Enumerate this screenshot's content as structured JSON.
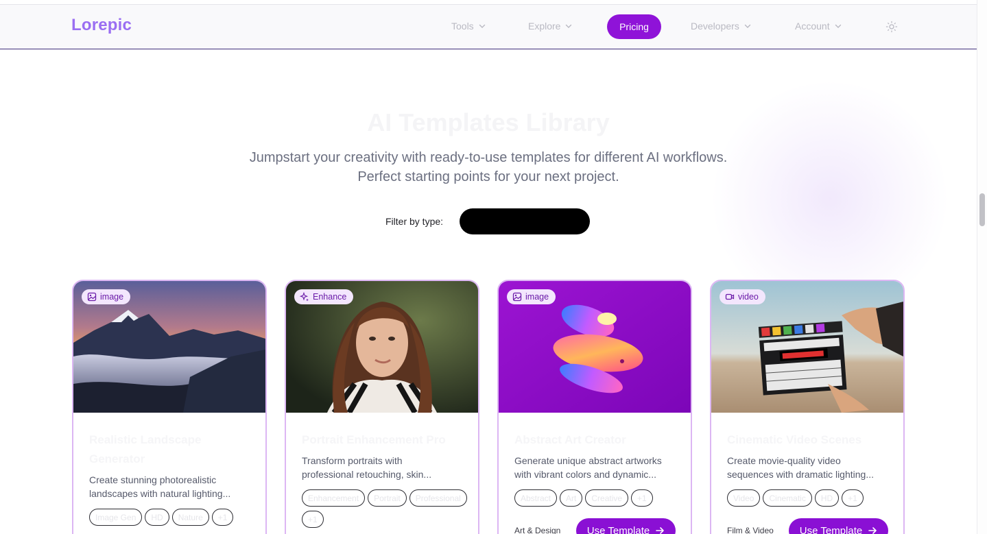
{
  "brand": {
    "logo_text": "Lorepic"
  },
  "nav": {
    "tools": "Tools",
    "explore": "Explore",
    "pricing": "Pricing",
    "developers": "Developers",
    "account": "Account"
  },
  "hero": {
    "title": "AI Templates Library",
    "subtitle_line1": "Jumpstart your creativity with ready-to-use templates for different AI workflows.",
    "subtitle_line2": "Perfect starting points for your next project."
  },
  "filter": {
    "label": "Filter by type:",
    "value": ""
  },
  "cards": [
    {
      "badge": "image",
      "badge_icon": "image-icon",
      "title": "Realistic Landscape Generator",
      "desc_line1": "Create stunning photorealistic",
      "desc_line2": "landscapes with natural lighting...",
      "tags": [
        "Image Gen",
        "HD",
        "Nature",
        "+1"
      ],
      "category": "",
      "button": ""
    },
    {
      "badge": "Enhance",
      "badge_icon": "sparkles-icon",
      "title": "Portrait Enhancement Pro",
      "desc_line1": "Transform portraits with",
      "desc_line2": "professional retouching, skin...",
      "tags": [
        "Enhancement",
        "Portrait",
        "Professional",
        "+1"
      ],
      "category": "",
      "button": ""
    },
    {
      "badge": "image",
      "badge_icon": "image-icon",
      "title": "Abstract Art Creator",
      "desc_line1": "Generate unique abstract artworks",
      "desc_line2": "with vibrant colors and dynamic...",
      "tags": [
        "Abstract",
        "Art",
        "Creative",
        "+1"
      ],
      "category": "Art & Design",
      "button": "Use Template"
    },
    {
      "badge": "video",
      "badge_icon": "video-camera-icon",
      "title": "Cinematic Video Scenes",
      "desc_line1": "Create movie-quality video",
      "desc_line2": "sequences with dramatic lighting...",
      "tags": [
        "Video",
        "Cinematic",
        "HD",
        "+1"
      ],
      "category": "Film & Video",
      "button": "Use Template"
    }
  ],
  "colors": {
    "accent": "#8f13d8",
    "logo": "#9a6ef2",
    "card_border": "#dcb6f3",
    "badge_bg": "#f3e6fd"
  }
}
